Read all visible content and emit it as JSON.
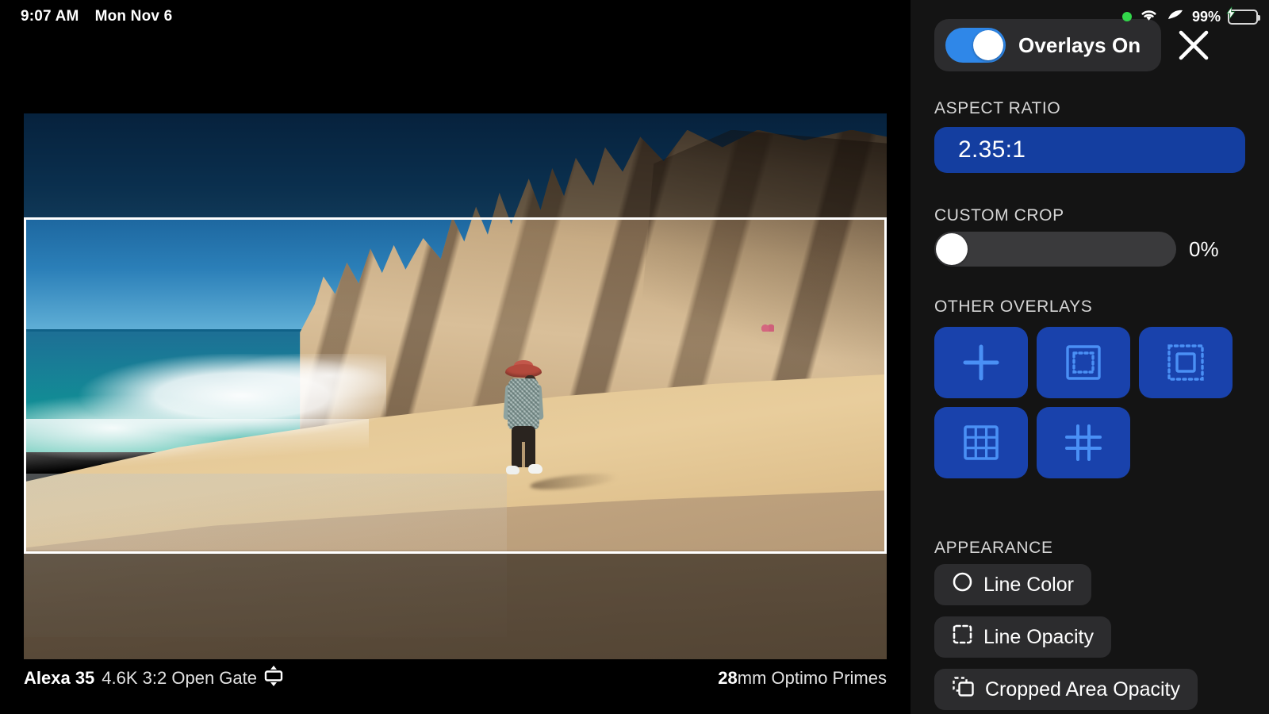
{
  "status_bar": {
    "time": "9:07 AM",
    "date": "Mon Nov 6",
    "battery_percent": "99%",
    "icons": [
      "green-recording-dot",
      "wifi-icon",
      "cellular-icon",
      "battery-charging-icon"
    ]
  },
  "viewfinder": {
    "info_bar": {
      "camera": "Alexa 35",
      "format": "4.6K 3:2 Open Gate",
      "sensor_icon": "sensor-format-icon",
      "lens_focal": "28",
      "lens_name": "mm Optimo Primes"
    },
    "overlay": {
      "frame_color": "#ffffff",
      "cropped_area_shade": "rgba(0,0,0,0.46)"
    }
  },
  "panel": {
    "overlays_toggle": {
      "label": "Overlays On",
      "state": "on",
      "accent": "#2f87e8"
    },
    "close_icon": "close-icon",
    "aspect_ratio": {
      "section_label": "ASPECT RATIO",
      "value": "2.35:1",
      "pill_color": "#143ea0"
    },
    "custom_crop": {
      "section_label": "CUSTOM CROP",
      "value": "0%",
      "slider_position": 0
    },
    "other_overlays": {
      "section_label": "OTHER OVERLAYS",
      "buttons": [
        {
          "name": "center-crosshair-overlay",
          "icon": "plus-icon"
        },
        {
          "name": "action-safe-overlay",
          "icon": "dotted-inner-square-icon"
        },
        {
          "name": "title-safe-overlay",
          "icon": "dotted-outer-square-icon"
        },
        {
          "name": "grid-overlay",
          "icon": "grid-3x3-icon"
        },
        {
          "name": "thirds-overlay",
          "icon": "hash-thirds-icon"
        }
      ],
      "button_color": "#1942ac",
      "glyph_color": "#4a90f5"
    },
    "appearance": {
      "section_label": "APPEARANCE",
      "rows": [
        {
          "label": "Line Color",
          "icon": "circle-icon"
        },
        {
          "label": "Line Opacity",
          "icon": "dashed-square-icon"
        },
        {
          "label": "Cropped Area Opacity",
          "icon": "overlapping-squares-icon"
        }
      ]
    }
  }
}
